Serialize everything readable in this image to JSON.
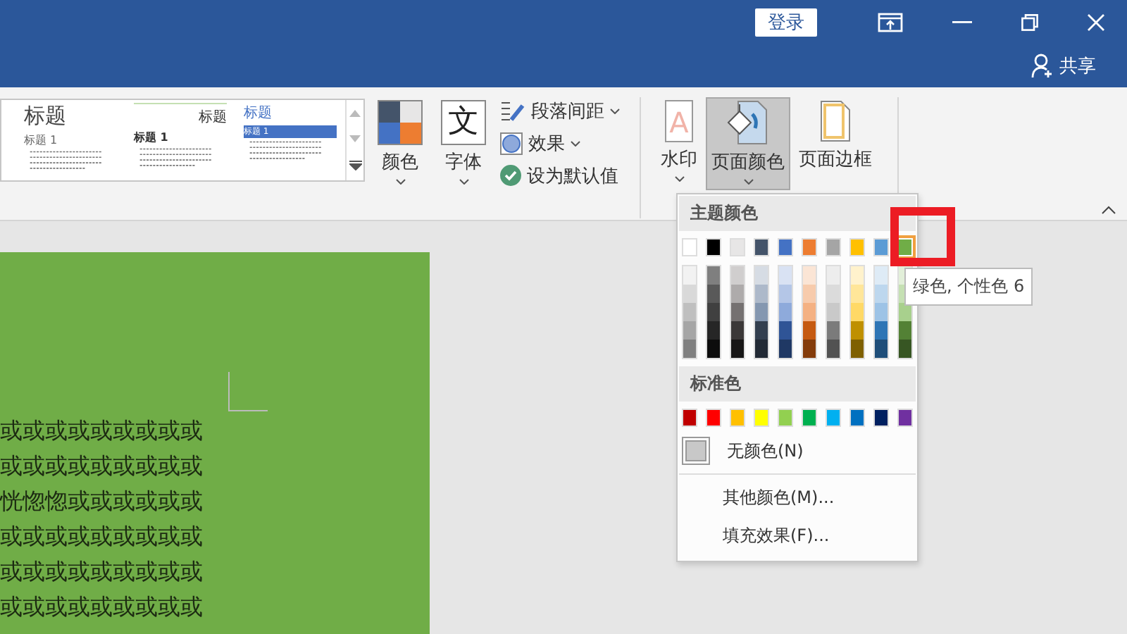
{
  "title_bar": {
    "sign_in": "登录",
    "share": "共享"
  },
  "ribbon": {
    "style_gallery": [
      {
        "heading": "标题",
        "subheading": "标题 1"
      },
      {
        "heading": "标题",
        "subheading": "标题 1"
      },
      {
        "heading": "标题",
        "subheading": "标题 1"
      }
    ],
    "big_buttons": [
      {
        "kind": "colors",
        "label": "颜色",
        "dropdown": true,
        "selected": false
      },
      {
        "kind": "fonts",
        "label": "字体",
        "glyph": "文",
        "dropdown": true,
        "selected": false
      }
    ],
    "small_buttons": [
      {
        "kind": "spacing",
        "label": "段落间距",
        "dropdown": true
      },
      {
        "kind": "effects",
        "label": "效果",
        "dropdown": true
      },
      {
        "kind": "default",
        "label": "设为默认值",
        "dropdown": false
      }
    ],
    "page_buttons": [
      {
        "kind": "watermark",
        "label": "水印",
        "glyph": "A",
        "dropdown": true,
        "selected": false
      },
      {
        "kind": "page_color",
        "label": "页面颜色",
        "dropdown": true,
        "selected": true
      },
      {
        "kind": "page_border",
        "label": "页面边框",
        "dropdown": false,
        "selected": false
      }
    ]
  },
  "color_menu": {
    "theme_header": "主题颜色",
    "theme_colors": [
      {
        "color": "#ffffff",
        "selected": false,
        "shades": [
          {
            "color": "#f2f2f2"
          },
          {
            "color": "#d9d9d9"
          },
          {
            "color": "#bfbfbf"
          },
          {
            "color": "#a6a6a6"
          },
          {
            "color": "#808080"
          }
        ]
      },
      {
        "color": "#000000",
        "selected": false,
        "shades": [
          {
            "color": "#7f7f7f"
          },
          {
            "color": "#595959"
          },
          {
            "color": "#404040"
          },
          {
            "color": "#262626"
          },
          {
            "color": "#0d0d0d"
          }
        ]
      },
      {
        "color": "#e7e6e6",
        "selected": false,
        "shades": [
          {
            "color": "#d0cece"
          },
          {
            "color": "#aeabab"
          },
          {
            "color": "#757171"
          },
          {
            "color": "#3b3838"
          },
          {
            "color": "#171616"
          }
        ]
      },
      {
        "color": "#44546a",
        "selected": false,
        "shades": [
          {
            "color": "#d6dce4"
          },
          {
            "color": "#adb9ca"
          },
          {
            "color": "#8497b0"
          },
          {
            "color": "#333f4f"
          },
          {
            "color": "#222a35"
          }
        ]
      },
      {
        "color": "#4472c4",
        "selected": false,
        "shades": [
          {
            "color": "#d9e2f3"
          },
          {
            "color": "#b4c6e7"
          },
          {
            "color": "#8eaadb"
          },
          {
            "color": "#2f5496"
          },
          {
            "color": "#1f3864"
          }
        ]
      },
      {
        "color": "#ed7d31",
        "selected": false,
        "shades": [
          {
            "color": "#fbe5d5"
          },
          {
            "color": "#f7cbac"
          },
          {
            "color": "#f4b183"
          },
          {
            "color": "#c55a11"
          },
          {
            "color": "#843c0b"
          }
        ]
      },
      {
        "color": "#a5a5a5",
        "selected": false,
        "shades": [
          {
            "color": "#ededed"
          },
          {
            "color": "#dbdbdb"
          },
          {
            "color": "#c9c9c9"
          },
          {
            "color": "#7b7b7b"
          },
          {
            "color": "#525252"
          }
        ]
      },
      {
        "color": "#ffc000",
        "selected": false,
        "shades": [
          {
            "color": "#fff2cc"
          },
          {
            "color": "#ffe699"
          },
          {
            "color": "#ffd966"
          },
          {
            "color": "#bf9000"
          },
          {
            "color": "#7f6000"
          }
        ]
      },
      {
        "color": "#5b9bd5",
        "selected": false,
        "shades": [
          {
            "color": "#deebf6"
          },
          {
            "color": "#bdd7ee"
          },
          {
            "color": "#9dc3e6"
          },
          {
            "color": "#2e75b5"
          },
          {
            "color": "#1f4e79"
          }
        ]
      },
      {
        "color": "#70ad47",
        "selected": true,
        "shades": [
          {
            "color": "#e2efd9"
          },
          {
            "color": "#c5e0b3"
          },
          {
            "color": "#a8d08d"
          },
          {
            "color": "#538135"
          },
          {
            "color": "#375623"
          }
        ]
      }
    ],
    "standard_header": "标准色",
    "standard_colors": [
      {
        "color": "#c00000"
      },
      {
        "color": "#ff0000"
      },
      {
        "color": "#ffc000"
      },
      {
        "color": "#ffff00"
      },
      {
        "color": "#92d050"
      },
      {
        "color": "#00b050"
      },
      {
        "color": "#00b0f0"
      },
      {
        "color": "#0070c0"
      },
      {
        "color": "#002060"
      },
      {
        "color": "#7030a0"
      }
    ],
    "no_color": "无颜色(N)",
    "more_colors": "其他颜色(M)...",
    "fill_effects": "填充效果(F)...",
    "tooltip": "绿色, 个性色 6"
  },
  "document": {
    "lines": [
      "或或或或或或或或或",
      "或或或或或或或或或",
      "恍惚惚或或或或或或",
      "或或或或或或或或或",
      "或或或或或或或或或",
      "或或或或或或或或或"
    ]
  }
}
